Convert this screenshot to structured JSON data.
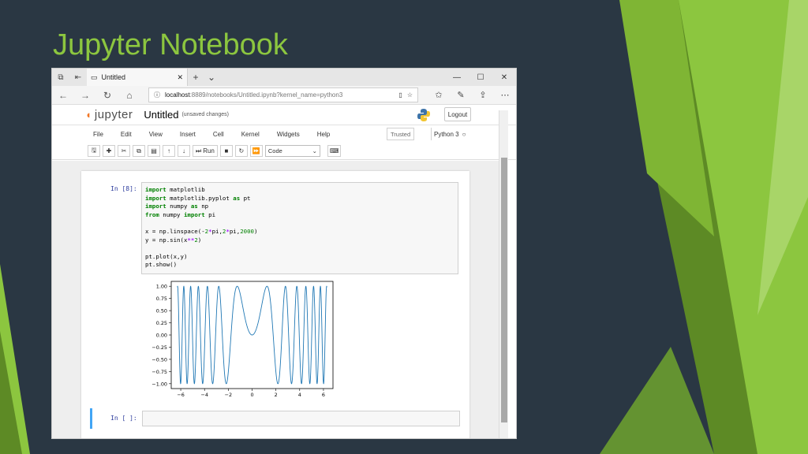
{
  "slide": {
    "title": "Jupyter Notebook"
  },
  "browser": {
    "tab": {
      "label": "Untitled"
    },
    "address": {
      "host": "localhost",
      "path": ":8889/notebooks/Untitled.ipynb?kernel_name=python3"
    }
  },
  "jupyter": {
    "logo_text": "jupyter",
    "notebook_title": "Untitled",
    "save_status": "(unsaved changes)",
    "logout_label": "Logout",
    "menu": [
      "File",
      "Edit",
      "View",
      "Insert",
      "Cell",
      "Kernel",
      "Widgets",
      "Help"
    ],
    "trusted_label": "Trusted",
    "kernel_name": "Python 3",
    "toolbar": {
      "run_label": "Run",
      "cell_type": "Code"
    }
  },
  "cells": {
    "cell1_prompt": "In [8]:",
    "cell2_prompt": "In [ ]:",
    "code_lines": [
      "import matplotlib",
      "import matplotlib.pyplot as pt",
      "import numpy as np",
      "from numpy import pi",
      "",
      "x = np.linspace(-2*pi,2*pi,2000)",
      "y = np.sin(x**2)",
      "",
      "pt.plot(x,y)",
      "pt.show()"
    ]
  },
  "colors": {
    "slide_bg": "#2a3743",
    "accent_green": "#8cc63f",
    "plot_line": "#1f77b4",
    "prompt_blue": "#303f9f"
  },
  "chart_data": {
    "type": "line",
    "title": "",
    "xlabel": "",
    "ylabel": "",
    "function": "y = sin(x^2)",
    "xlim": [
      -6.8,
      6.8
    ],
    "ylim": [
      -1.1,
      1.1
    ],
    "xticks": [
      -6,
      -4,
      -2,
      0,
      2,
      4,
      6
    ],
    "yticks": [
      1.0,
      0.75,
      0.5,
      0.25,
      0.0,
      -0.25,
      -0.5,
      -0.75,
      -1.0
    ],
    "ytick_labels": [
      "1.00",
      "0.75",
      "0.50",
      "0.25",
      "0.00",
      "−0.25",
      "−0.50",
      "−0.75",
      "−1.00"
    ],
    "xtick_labels": [
      "−6",
      "−4",
      "−2",
      "0",
      "2",
      "4",
      "6"
    ],
    "x_range": [
      -6.283,
      6.283
    ],
    "num_points": 2000
  }
}
